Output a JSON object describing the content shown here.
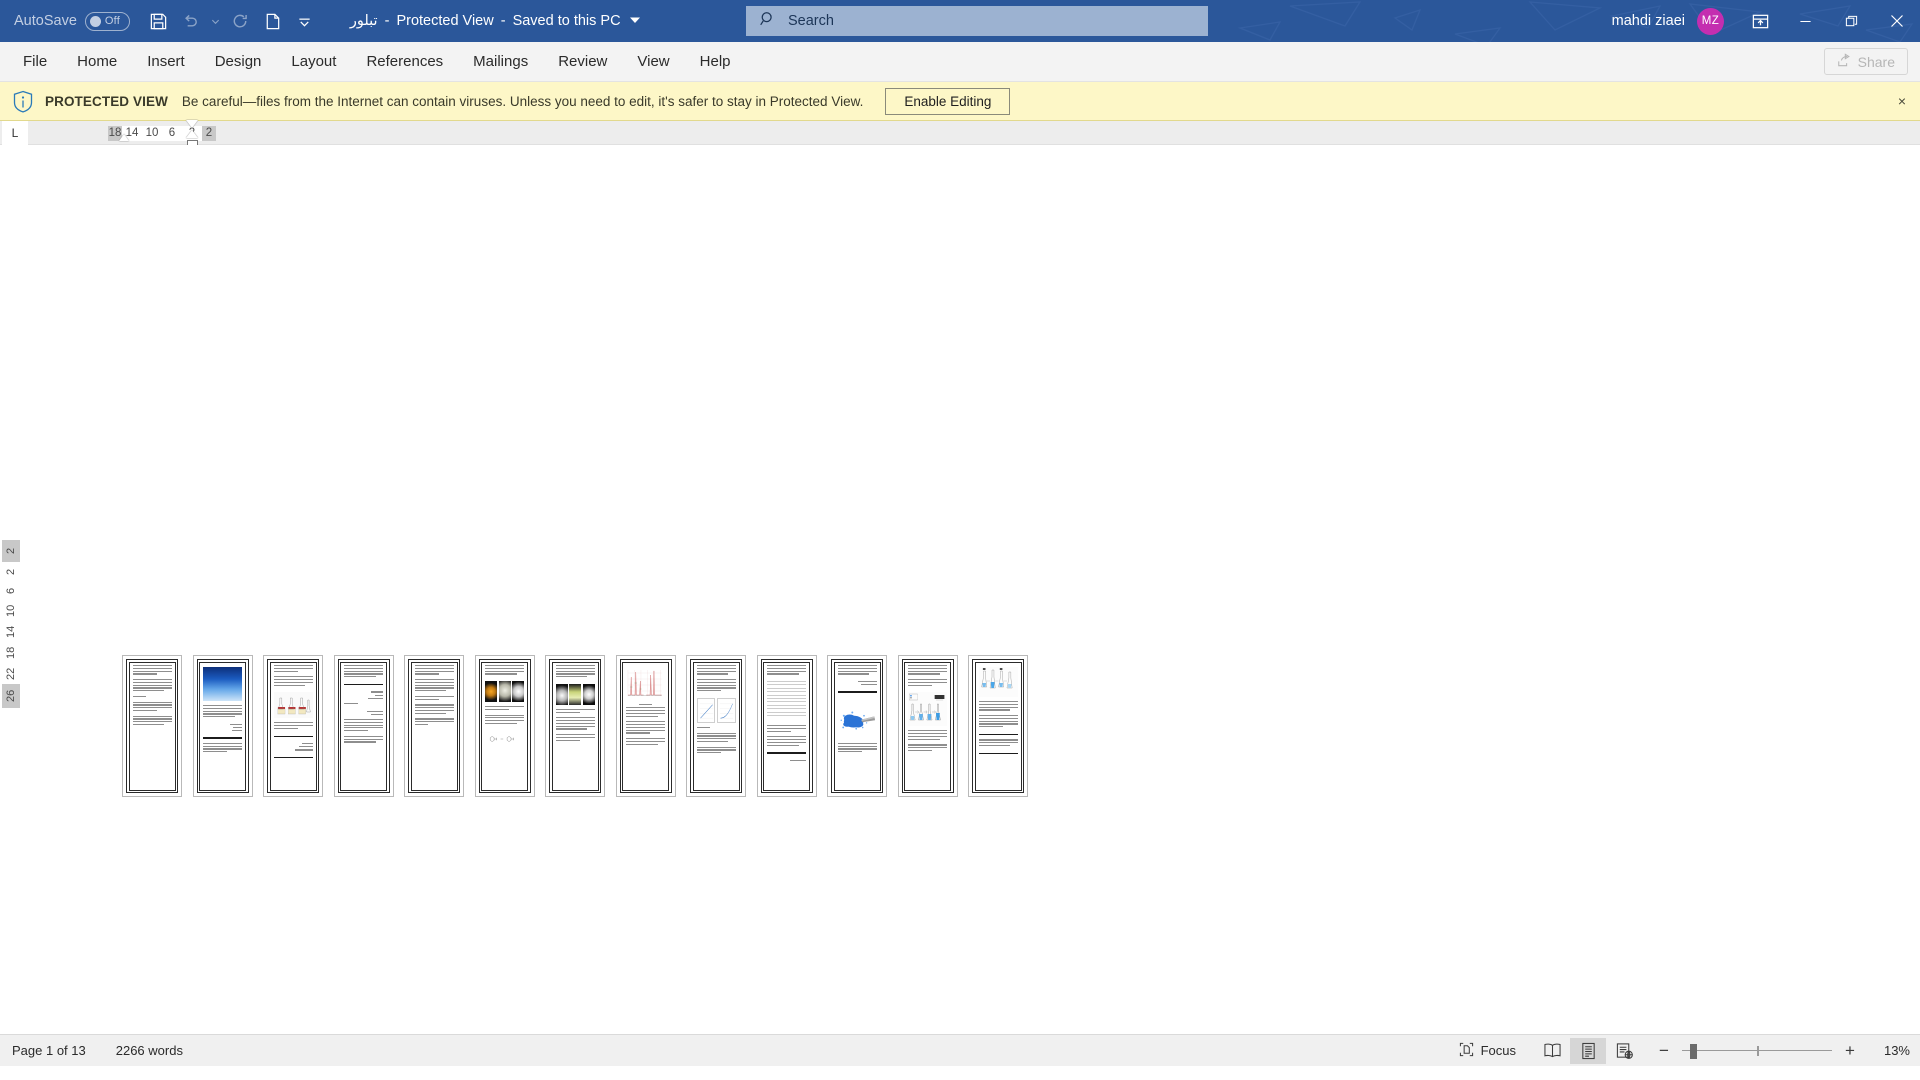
{
  "titlebar": {
    "autosave_label": "AutoSave",
    "autosave_state": "Off",
    "quick_access": [
      {
        "name": "save-icon",
        "label": "Save"
      },
      {
        "name": "undo-icon",
        "label": "Undo"
      },
      {
        "name": "undo-dropdown-icon",
        "label": "Undo options"
      },
      {
        "name": "redo-icon",
        "label": "Redo"
      },
      {
        "name": "new-document-icon",
        "label": "New"
      },
      {
        "name": "customize-quick-access-icon",
        "label": "Customize Quick Access Toolbar"
      }
    ],
    "doc_name": "تبلور",
    "sep1": "-",
    "protected_view": "Protected View",
    "sep2": "-",
    "save_location": "Saved to this PC",
    "dropdown_caret": "⌄",
    "search_placeholder": "Search",
    "search_value": "",
    "account_name": "mahdi ziaei",
    "account_initials": "MZ",
    "ribbon_display_title": "Ribbon Display Options",
    "minimize": "Minimize",
    "restore": "Restore Down",
    "close": "Close",
    "accent_color": "#2b579a",
    "avatar_color": "#c42eb0"
  },
  "ribbon": {
    "tabs": [
      {
        "label": "File"
      },
      {
        "label": "Home"
      },
      {
        "label": "Insert"
      },
      {
        "label": "Design"
      },
      {
        "label": "Layout"
      },
      {
        "label": "References"
      },
      {
        "label": "Mailings"
      },
      {
        "label": "Review"
      },
      {
        "label": "View"
      },
      {
        "label": "Help"
      }
    ],
    "share_label": "Share",
    "share_disabled": true
  },
  "protected_view": {
    "badge": "PROTECTED VIEW",
    "message": "Be careful—files from the Internet can contain viruses. Unless you need to edit, it's safer to stay in Protected View.",
    "enable_button": "Enable Editing",
    "close_label": "×",
    "bar_color": "#fdf7c7"
  },
  "ruler": {
    "tab_stop_glyph": "L",
    "horizontal_ticks": [
      "18",
      "14",
      "10",
      "6",
      "2",
      "2"
    ],
    "vertical_ticks": [
      "2",
      "2",
      "6",
      "10",
      "14",
      "18",
      "22",
      "26"
    ]
  },
  "document": {
    "page_count": 13,
    "pages": [
      {
        "num": 1,
        "kind": "text"
      },
      {
        "num": 2,
        "kind": "crystal-image"
      },
      {
        "num": 3,
        "kind": "flask-diagram"
      },
      {
        "num": 4,
        "kind": "text-bullets"
      },
      {
        "num": 5,
        "kind": "text-heading"
      },
      {
        "num": 6,
        "kind": "photo-strip-chem"
      },
      {
        "num": 7,
        "kind": "photo-strip"
      },
      {
        "num": 8,
        "kind": "spectra-chart"
      },
      {
        "num": 9,
        "kind": "line-charts"
      },
      {
        "num": 10,
        "kind": "data-table"
      },
      {
        "num": 11,
        "kind": "blue-powder-image"
      },
      {
        "num": 12,
        "kind": "apparatus-diagram"
      },
      {
        "num": 13,
        "kind": "apparatus-diagram-2"
      }
    ]
  },
  "statusbar": {
    "page_indicator": "Page 1 of 13",
    "word_count": "2266 words",
    "focus_label": "Focus",
    "views": [
      {
        "name": "read-mode-icon",
        "label": "Read Mode",
        "active": false
      },
      {
        "name": "print-layout-icon",
        "label": "Print Layout",
        "active": true
      },
      {
        "name": "web-layout-icon",
        "label": "Web Layout",
        "active": false
      }
    ],
    "zoom_out": "−",
    "zoom_in": "+",
    "zoom_level": "13%"
  }
}
